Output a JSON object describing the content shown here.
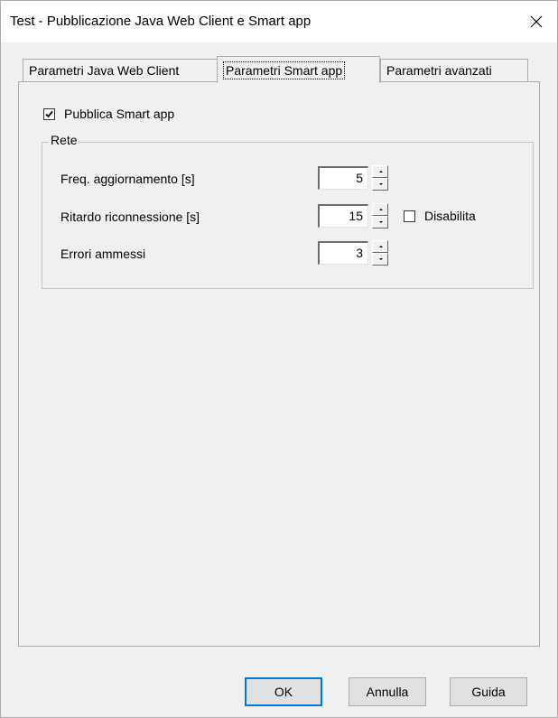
{
  "window": {
    "title": "Test - Pubblicazione Java Web Client e Smart app"
  },
  "tabs": [
    {
      "label": "Parametri Java Web Client"
    },
    {
      "label": "Parametri Smart app"
    },
    {
      "label": "Parametri avanzati"
    }
  ],
  "active_tab": "Parametri Smart app",
  "publish": {
    "label": "Pubblica Smart app",
    "checked": true
  },
  "network": {
    "legend": "Rete",
    "update_freq": {
      "label": "Freq. aggiornamento [s]",
      "value": "5"
    },
    "reconnect_delay": {
      "label": "Ritardo riconnessione [s]",
      "value": "15"
    },
    "disable": {
      "label": "Disabilita",
      "checked": false
    },
    "allowed_errors": {
      "label": "Errori ammessi",
      "value": "3"
    }
  },
  "buttons": {
    "ok": "OK",
    "cancel": "Annulla",
    "help": "Guida"
  }
}
